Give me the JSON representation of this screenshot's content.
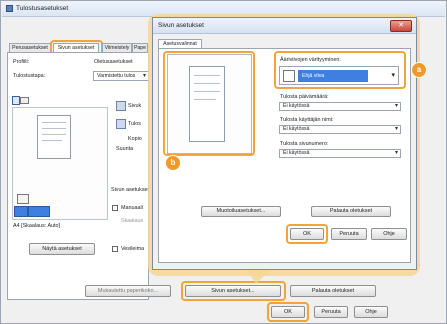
{
  "main": {
    "title": "Tulostusasetukset",
    "tabs": [
      "Perusasetukset",
      "Sivun asetukset",
      "Viimeistely",
      "Pape"
    ],
    "profile_label": "Profiili:",
    "profile_value": "Oletusasetukset",
    "output_method_label": "Tulostustapa:",
    "output_method_value": "Varmistettu tulos",
    "partial_labels": [
      "Sivuk",
      "Tulos",
      "Kopio",
      "Suunta"
    ],
    "page_settings_label": "Sivun asetukset",
    "manual_label": "Manuaali",
    "scale_label": "Skaalaus",
    "paper_size_text": "A4 [Skaalaus: Auto]",
    "show_settings_button": "Näytä asetukset",
    "grayscale_label": "Vesileima",
    "custom_paper_button": "Mukautettu paperikoko...",
    "page_options_button": "Sivun asetukset...",
    "restore_defaults_button": "Palauta oletukset",
    "ok_button": "OK",
    "cancel_button": "Peruuta",
    "help_button": "Ohje"
  },
  "popup": {
    "title": "Sivun asetukset",
    "tab": "Asetusvalinnat",
    "color_label": "Ääriviivojen värityyminen:",
    "color_value": "Ehjä viiva",
    "date_label": "Tulosta päivämäärä:",
    "date_value": "Ei käytössä",
    "user_label": "Tulosta käyttäjän nimi:",
    "user_value": "Ei käytössä",
    "pagenum_label": "Tulosta sivunumero:",
    "pagenum_value": "Ei käytössä",
    "format_button": "Muotoiluasetukset...",
    "restore_button": "Palauta oletukset",
    "ok_button": "OK",
    "cancel_button": "Peruuta",
    "help_button": "Ohje",
    "close_glyph": "✕"
  },
  "badges": {
    "a": "a",
    "b": "b"
  },
  "colors": {
    "highlight": "#f2a33a",
    "badge": "#ef9a2a",
    "selection": "#3f7fe0"
  },
  "icons": [
    "printer-icon",
    "close-icon",
    "page-layout-icon",
    "portrait-icon",
    "landscape-icon",
    "dropdown-arrow-icon"
  ]
}
